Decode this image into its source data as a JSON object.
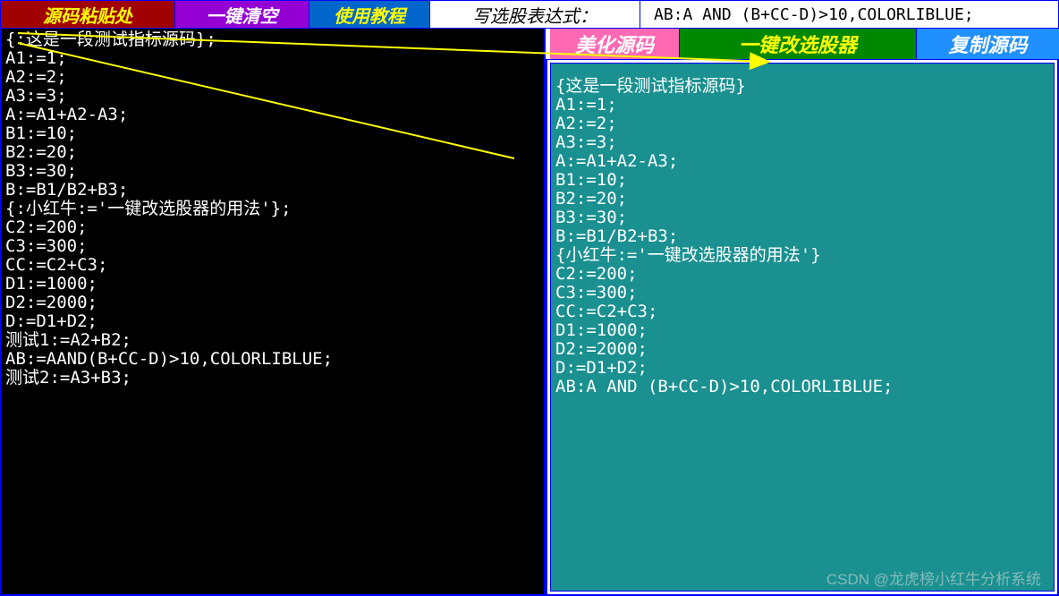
{
  "top_bar": {
    "paste_label": "源码粘贴处",
    "clear_label": "一键清空",
    "tutorial_label": "使用教程",
    "expr_label": "写选股表达式：",
    "expr_value": "AB:A AND (B+CC-D)>10,COLORLIBLUE;"
  },
  "right_toolbar": {
    "beautify_label": "美化源码",
    "convert_label": "一键改选股器",
    "copy_label": "复制源码"
  },
  "left_code": "{:这是一段测试指标源码};\nA1:=1;\nA2:=2;\nA3:=3;\nA:=A1+A2-A3;\nB1:=10;\nB2:=20;\nB3:=30;\nB:=B1/B2+B3;\n{:小红牛:='一键改选股器的用法'};\nC2:=200;\nC3:=300;\nCC:=C2+C3;\nD1:=1000;\nD2:=2000;\nD:=D1+D2;\n测试1:=A2+B2;\nAB:=AAND(B+CC-D)>10,COLORLIBLUE;\n测试2:=A3+B3;",
  "right_code": "{这是一段测试指标源码}\nA1:=1;\nA2:=2;\nA3:=3;\nA:=A1+A2-A3;\nB1:=10;\nB2:=20;\nB3:=30;\nB:=B1/B2+B3;\n{小红牛:='一键改选股器的用法'}\nC2:=200;\nC3:=300;\nCC:=C2+C3;\nD1:=1000;\nD2:=2000;\nD:=D1+D2;\nAB:A AND (B+CC-D)>10,COLORLIBLUE;",
  "watermark": "CSDN @龙虎榜小红牛分析系统"
}
